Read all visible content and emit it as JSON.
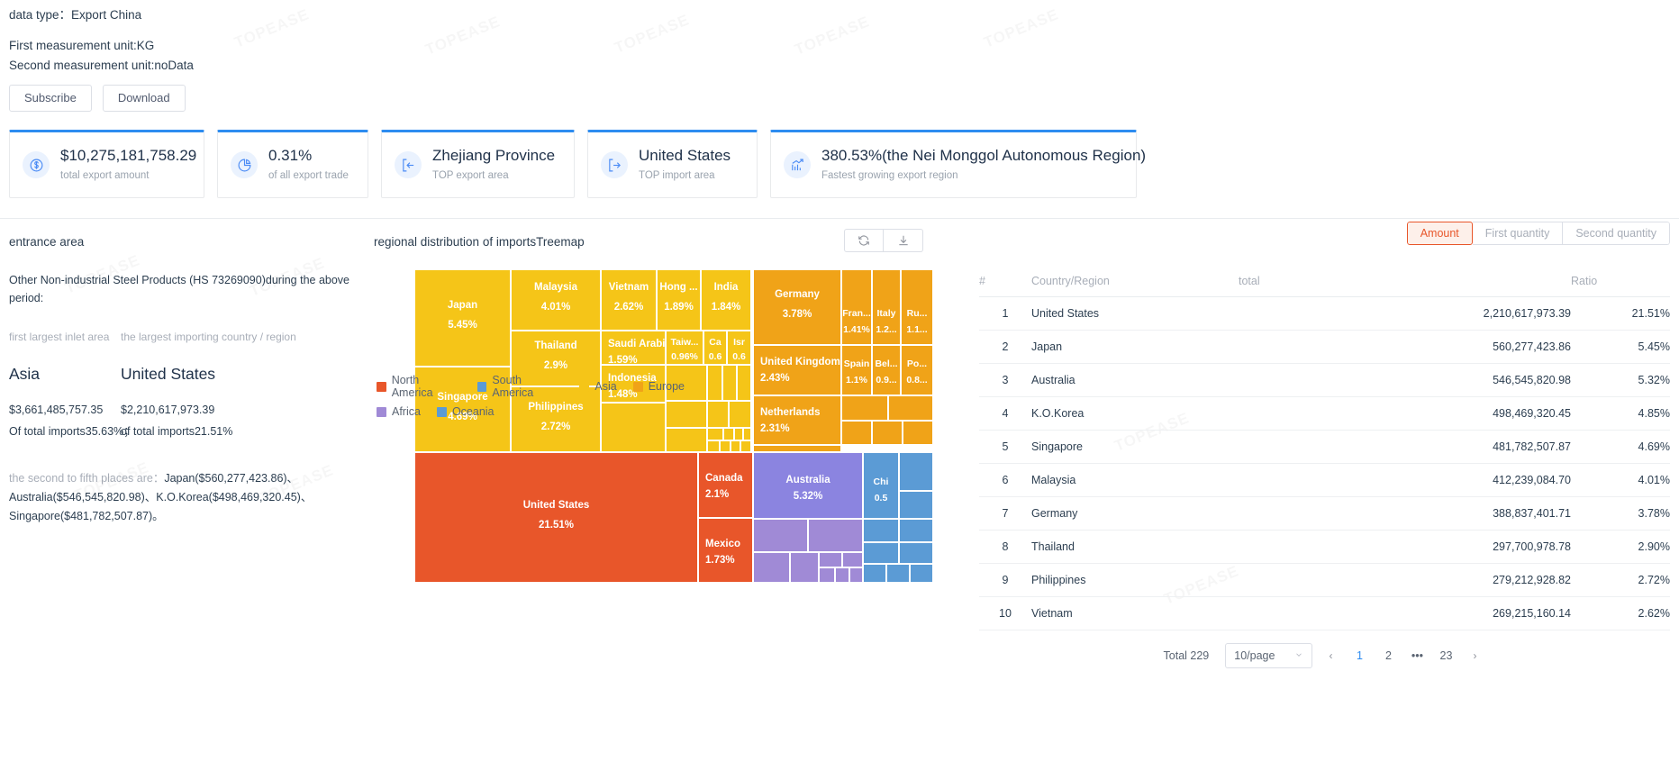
{
  "header": {
    "data_type_label": "data type：",
    "data_type_value": "Export China",
    "first_unit": "First measurement unit:KG",
    "second_unit": "Second measurement unit:noData"
  },
  "actions": {
    "subscribe": "Subscribe",
    "download": "Download"
  },
  "cards": [
    {
      "icon": "dollar-circle-icon",
      "value": "$10,275,181,758.29",
      "label": "total export amount"
    },
    {
      "icon": "pie-chart-icon",
      "value": "0.31%",
      "label": "of all export trade"
    },
    {
      "icon": "export-area-icon",
      "value": "Zhejiang Province",
      "label": "TOP export area"
    },
    {
      "icon": "import-area-icon",
      "value": "United States",
      "label": "TOP import area"
    },
    {
      "icon": "growth-chart-icon",
      "value": "380.53%(the Nei Monggol Autonomous Region)",
      "label": "Fastest growing export region"
    }
  ],
  "left_panel": {
    "title": "entrance area",
    "description": "Other Non-industrial Steel Products (HS 73269090)during the above period:",
    "col_a_label": "first largest inlet area",
    "col_b_label": "the largest importing country / region",
    "col_a_value": "Asia",
    "col_b_value": "United States",
    "col_a_amount": "$3,661,485,757.35",
    "col_b_amount": "$2,210,617,973.39",
    "col_a_share": "Of total imports35.63%；",
    "col_b_share": "of total imports21.51%",
    "rest_lead": "the second to fifth places are：",
    "rest_line1": "Japan($560,277,423.86)、",
    "rest_line2": "Australia($546,545,820.98)、K.O.Korea($498,469,320.45)、",
    "rest_line3": "Singapore($481,782,507.87)。"
  },
  "treemap_panel": {
    "title": "regional distribution of importsTreemap",
    "refresh_icon": "refresh-icon",
    "download_icon": "download-icon"
  },
  "colors": {
    "asia": "#f5c518",
    "europe": "#f0a318",
    "north_america": "#e8562a",
    "oceania": "#8b84e0",
    "south_america": "#5b9bd5",
    "africa": "#a08ad6",
    "accent": "#2d8cf0",
    "active": "#e8562a"
  },
  "chart_data": {
    "type": "treemap",
    "title": "regional distribution of importsTreemap",
    "legend_position": "bottom-left",
    "legend": [
      {
        "label": "North America",
        "color": "#e8562a"
      },
      {
        "label": "South America",
        "color": "#5b9bd5"
      },
      {
        "label": "Asia",
        "color": "#f5c518"
      },
      {
        "label": "Europe",
        "color": "#f0a318"
      },
      {
        "label": "Africa",
        "color": "#a08ad6"
      },
      {
        "label": "Oceania",
        "color": "#5b9bd5"
      }
    ],
    "groups": [
      {
        "name": "Asia",
        "color": "#f5c518",
        "items": [
          {
            "label": "Japan",
            "value": "5.45%"
          },
          {
            "label": "Malaysia",
            "value": "4.01%"
          },
          {
            "label": "Vietnam",
            "value": "2.62%"
          },
          {
            "label": "Hong ...",
            "value": "1.89%"
          },
          {
            "label": "India",
            "value": "1.84%"
          },
          {
            "label": "Thailand",
            "value": "2.9%"
          },
          {
            "label": "Saudi Arabia",
            "value": "1.59%"
          },
          {
            "label": "Taiw...",
            "value": "0.96%"
          },
          {
            "label": "Ca",
            "value": "0.6"
          },
          {
            "label": "Isr",
            "value": "0.6"
          },
          {
            "label": "Singapore",
            "value": "4.69%"
          },
          {
            "label": "Philippines",
            "value": "2.72%"
          },
          {
            "label": "Indonesia",
            "value": "1.48%"
          }
        ]
      },
      {
        "name": "Europe",
        "color": "#f0a318",
        "items": [
          {
            "label": "Germany",
            "value": "3.78%"
          },
          {
            "label": "Fran...",
            "value": "1.41%"
          },
          {
            "label": "Italy",
            "value": "1.2..."
          },
          {
            "label": "Ru...",
            "value": "1.1..."
          },
          {
            "label": "United Kingdom",
            "value": "2.43%"
          },
          {
            "label": "Spain",
            "value": "1.1%"
          },
          {
            "label": "Bel...",
            "value": "0.9..."
          },
          {
            "label": "Po...",
            "value": "0.8..."
          },
          {
            "label": "Netherlands",
            "value": "2.31%"
          }
        ]
      },
      {
        "name": "North America",
        "color": "#e8562a",
        "items": [
          {
            "label": "United States",
            "value": "21.51%"
          },
          {
            "label": "Canada",
            "value": "2.1%"
          },
          {
            "label": "Mexico",
            "value": "1.73%"
          }
        ]
      },
      {
        "name": "Oceania",
        "color": "#8b84e0",
        "items": [
          {
            "label": "Australia",
            "value": "5.32%"
          }
        ]
      },
      {
        "name": "South America",
        "color": "#5b9bd5",
        "items": [
          {
            "label": "Chi",
            "value": "0.5"
          }
        ]
      }
    ]
  },
  "table": {
    "segments": [
      {
        "label": "Amount",
        "active": true
      },
      {
        "label": "First quantity",
        "active": false
      },
      {
        "label": "Second quantity",
        "active": false
      }
    ],
    "columns": [
      "#",
      "Country/Region",
      "total",
      "Ratio"
    ],
    "rows": [
      {
        "idx": "1",
        "name": "United States",
        "total": "2,210,617,973.39",
        "ratio": "21.51%"
      },
      {
        "idx": "2",
        "name": "Japan",
        "total": "560,277,423.86",
        "ratio": "5.45%"
      },
      {
        "idx": "3",
        "name": "Australia",
        "total": "546,545,820.98",
        "ratio": "5.32%"
      },
      {
        "idx": "4",
        "name": "K.O.Korea",
        "total": "498,469,320.45",
        "ratio": "4.85%"
      },
      {
        "idx": "5",
        "name": "Singapore",
        "total": "481,782,507.87",
        "ratio": "4.69%"
      },
      {
        "idx": "6",
        "name": "Malaysia",
        "total": "412,239,084.70",
        "ratio": "4.01%"
      },
      {
        "idx": "7",
        "name": "Germany",
        "total": "388,837,401.71",
        "ratio": "3.78%"
      },
      {
        "idx": "8",
        "name": "Thailand",
        "total": "297,700,978.78",
        "ratio": "2.90%"
      },
      {
        "idx": "9",
        "name": "Philippines",
        "total": "279,212,928.82",
        "ratio": "2.72%"
      },
      {
        "idx": "10",
        "name": "Vietnam",
        "total": "269,215,160.14",
        "ratio": "2.62%"
      }
    ],
    "pagination": {
      "total_text": "Total 229",
      "page_size": "10/page",
      "prev": "‹",
      "next": "›",
      "pages": [
        "1",
        "2",
        "•••",
        "23"
      ],
      "current": "1"
    }
  },
  "watermark": "TOPEASE"
}
